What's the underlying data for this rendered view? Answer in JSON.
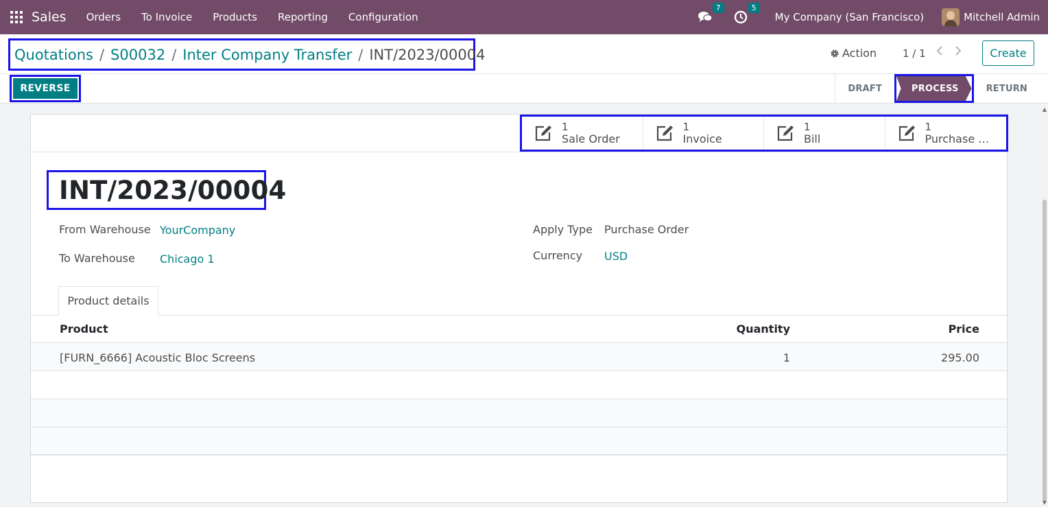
{
  "navbar": {
    "brand": "Sales",
    "menu": [
      "Orders",
      "To Invoice",
      "Products",
      "Reporting",
      "Configuration"
    ],
    "messages_badge": "7",
    "activities_badge": "5",
    "company": "My Company (San Francisco)",
    "user": "Mitchell Admin"
  },
  "breadcrumb": {
    "items": [
      "Quotations",
      "S00032",
      "Inter Company Transfer"
    ],
    "separator": "/",
    "current": "INT/2023/00004"
  },
  "control": {
    "action_label": "Action",
    "pager": "1 / 1",
    "create_label": "Create",
    "reverse_label": "REVERSE"
  },
  "statusbar": {
    "stages": [
      "DRAFT",
      "PROCESS",
      "RETURN"
    ],
    "active": "PROCESS"
  },
  "smart_buttons": [
    {
      "count": "1",
      "label": "Sale Order"
    },
    {
      "count": "1",
      "label": "Invoice"
    },
    {
      "count": "1",
      "label": "Bill"
    },
    {
      "count": "1",
      "label": "Purchase Order"
    }
  ],
  "record": {
    "title": "INT/2023/00004",
    "from_warehouse_label": "From Warehouse",
    "from_warehouse": "YourCompany",
    "to_warehouse_label": "To Warehouse",
    "to_warehouse": "Chicago 1",
    "apply_type_label": "Apply Type",
    "apply_type": "Purchase Order",
    "currency_label": "Currency",
    "currency": "USD"
  },
  "tabs": [
    "Product details"
  ],
  "table": {
    "columns": [
      "Product",
      "Quantity",
      "Price"
    ],
    "rows": [
      {
        "product": "[FURN_6666] Acoustic Bloc Screens",
        "quantity": "1",
        "price": "295.00"
      }
    ]
  },
  "colors": {
    "primary": "#714b67",
    "accent": "#017e84",
    "highlight_border": "#1a14e6"
  }
}
